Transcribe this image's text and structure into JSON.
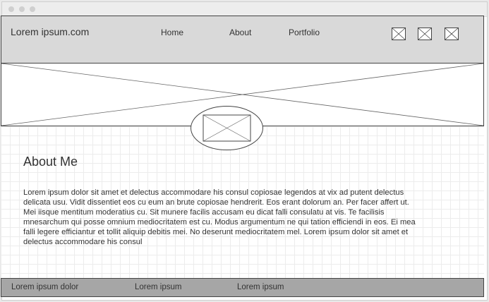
{
  "site": {
    "title": "Lorem ipsum.com"
  },
  "nav": {
    "items": [
      "Home",
      "About",
      "Portfolio"
    ]
  },
  "social": {
    "icons": [
      "image-placeholder-icon",
      "image-placeholder-icon",
      "image-placeholder-icon"
    ]
  },
  "hero": {
    "image": "image-placeholder"
  },
  "about": {
    "heading": "About Me",
    "body": "Lorem ipsum dolor sit amet et delectus accommodare his consul copiosae legendos at vix ad putent delectus delicata usu. Vidit dissentiet eos cu eum an brute copiosae hendrerit. Eos erant dolorum an. Per facer affert ut. Mei iisque mentitum moderatius cu. Sit munere facilis accusam eu dicat falli consulatu at vis. Te facilisis mnesarchum qui posse omnium mediocritatem est cu. Modus argumentum ne qui tation efficiendi in eos. Ei mea falli legere efficiantur et tollit aliquip debitis mei. No deserunt mediocritatem mel. Lorem ipsum dolor sit amet et delectus accommodare his consul"
  },
  "footer": {
    "links": [
      "Lorem ipsum dolor",
      "Lorem ipsum",
      "Lorem ipsum"
    ]
  },
  "colors": {
    "header_bg": "#d9d9d9",
    "footer_bg": "#a6a6a6",
    "border": "#444444",
    "grid": "#ececec",
    "text": "#333333"
  }
}
